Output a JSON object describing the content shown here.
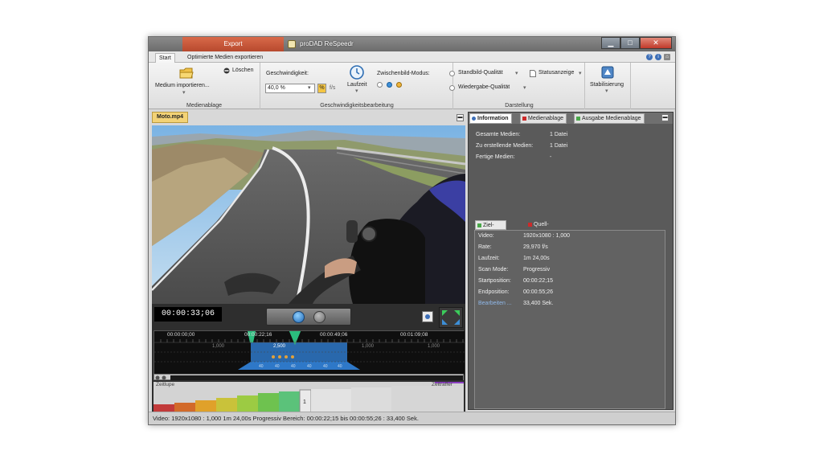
{
  "window": {
    "export_tab": "Export",
    "title": "proDAD ReSpeedr"
  },
  "ribbon_tabs": [
    "Start",
    "Optimierte Medien exportieren"
  ],
  "ribbon": {
    "medienablage": {
      "import_label": "Medium importieren...",
      "delete_label": "Löschen",
      "group_label": "Medienablage"
    },
    "geschwindigkeit": {
      "speed_label": "Geschwindigkeit:",
      "speed_value": "40,0 %",
      "percent_btn": "%",
      "fps_btn": "f/s",
      "laufzeit_label": "Laufzeit",
      "interp_label": "Zwischenbild-Modus:",
      "group_label": "Geschwindigkeitsbearbeitung"
    },
    "darstellung": {
      "still_quality": "Standbild-Qualität",
      "playback_quality": "Wiedergabe-Qualität",
      "status_display": "Statusanzeige",
      "group_label": "Darstellung"
    },
    "stabilisierung": {
      "label": "Stabilisierung"
    }
  },
  "video": {
    "file_name": "Moto.mp4",
    "timecode": "00:00:33;06"
  },
  "timeline": {
    "ruler": [
      "00:00:00;00",
      "00:00:22;16",
      "00:00:49;06",
      "00:01:09;08"
    ],
    "speed_labels": [
      "1,000",
      "2,500",
      "1,000",
      "1,000"
    ],
    "keyframes": [
      "40",
      "40",
      "40",
      "40",
      "40",
      "40"
    ]
  },
  "speed_curve": {
    "left_label": "Zeitlupe",
    "right_label": "Zeitraffer",
    "selected_value": "1"
  },
  "status_bar": "Video: 1920x1080 : 1,000   1m 24,00s   Progressiv   Bereich: 00:00:22;15 bis 00:00:55;26 : 33,400 Sek.",
  "right_panel": {
    "tabs": [
      "Information",
      "Medienablage",
      "Ausgabe Medienablage"
    ],
    "info": [
      {
        "key": "Gesamte Medien:",
        "value": "1 Datei"
      },
      {
        "key": "Zu erstellende Medien:",
        "value": "1 Datei"
      },
      {
        "key": "Fertige Medien:",
        "value": "-"
      }
    ],
    "sub_tabs": [
      "Ziel-Medium",
      "Quell-Medium"
    ],
    "details": [
      {
        "key": "Video:",
        "value": "1920x1080 : 1,000"
      },
      {
        "key": "Rate:",
        "value": "29,970 f/s"
      },
      {
        "key": "Laufzeit:",
        "value": "1m 24,00s"
      },
      {
        "key": "Scan Mode:",
        "value": "Progressiv"
      },
      {
        "key": "Startposition:",
        "value": "00:00:22;15"
      },
      {
        "key": "Endposition:",
        "value": "00:00:55;26"
      },
      {
        "key": "Bearbeiten ...",
        "value": "33,400 Sek."
      }
    ]
  },
  "colors": {
    "export_tab": "#c9563a",
    "panel_bg": "#5a5a5a",
    "file_tab": "#f3d276",
    "info_dot": "#3d6fb8",
    "media_dot": "#cc2a2a",
    "output_dot": "#4aa84a",
    "selection": "#2e78c8",
    "keyframe": "#e2a13a",
    "marker": "#2bbd7e"
  }
}
